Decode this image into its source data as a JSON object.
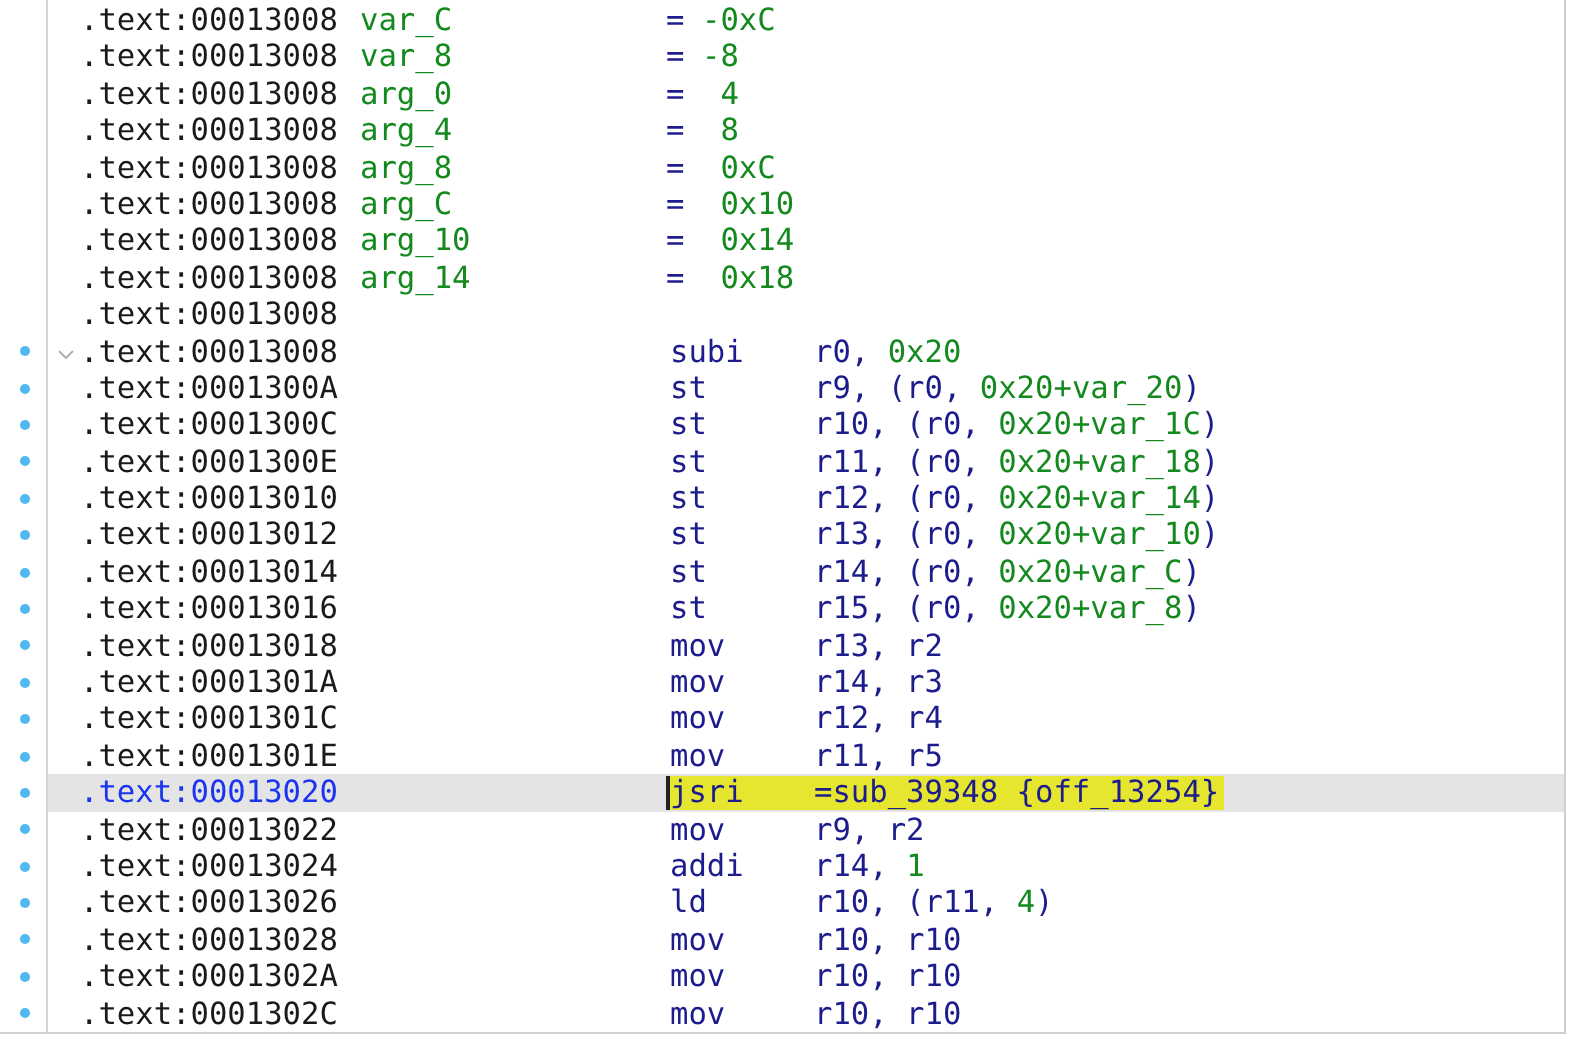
{
  "listing": {
    "rows": [
      {
        "kind": "stackvar",
        "address": ".text:00013008",
        "name": "var_C",
        "eq": "=",
        "value": "-0xC",
        "breakpoint": false,
        "selected": false
      },
      {
        "kind": "stackvar",
        "address": ".text:00013008",
        "name": "var_8",
        "eq": "=",
        "value": "-8",
        "breakpoint": false,
        "selected": false
      },
      {
        "kind": "stackvar",
        "address": ".text:00013008",
        "name": "arg_0",
        "eq": "=",
        "value": " 4",
        "breakpoint": false,
        "selected": false
      },
      {
        "kind": "stackvar",
        "address": ".text:00013008",
        "name": "arg_4",
        "eq": "=",
        "value": " 8",
        "breakpoint": false,
        "selected": false
      },
      {
        "kind": "stackvar",
        "address": ".text:00013008",
        "name": "arg_8",
        "eq": "=",
        "value": " 0xC",
        "breakpoint": false,
        "selected": false
      },
      {
        "kind": "stackvar",
        "address": ".text:00013008",
        "name": "arg_C",
        "eq": "=",
        "value": " 0x10",
        "breakpoint": false,
        "selected": false
      },
      {
        "kind": "stackvar",
        "address": ".text:00013008",
        "name": "arg_10",
        "eq": "=",
        "value": " 0x14",
        "breakpoint": false,
        "selected": false
      },
      {
        "kind": "stackvar",
        "address": ".text:00013008",
        "name": "arg_14",
        "eq": "=",
        "value": " 0x18",
        "breakpoint": false,
        "selected": false
      },
      {
        "kind": "blank",
        "address": ".text:00013008",
        "breakpoint": false,
        "selected": false
      },
      {
        "kind": "insn",
        "address": ".text:00013008",
        "collapsible": true,
        "mnemonic": "subi",
        "operands": [
          {
            "text": "r0, ",
            "kind": "plain"
          },
          {
            "text": "0x20",
            "kind": "const"
          }
        ],
        "breakpoint": true,
        "selected": false
      },
      {
        "kind": "insn",
        "address": ".text:0001300A",
        "mnemonic": "st",
        "operands": [
          {
            "text": "r9, (r0, ",
            "kind": "plain"
          },
          {
            "text": "0x20+var_20",
            "kind": "const"
          },
          {
            "text": ")",
            "kind": "plain"
          }
        ],
        "breakpoint": true,
        "selected": false
      },
      {
        "kind": "insn",
        "address": ".text:0001300C",
        "mnemonic": "st",
        "operands": [
          {
            "text": "r10, (r0, ",
            "kind": "plain"
          },
          {
            "text": "0x20+var_1C",
            "kind": "const"
          },
          {
            "text": ")",
            "kind": "plain"
          }
        ],
        "breakpoint": true,
        "selected": false
      },
      {
        "kind": "insn",
        "address": ".text:0001300E",
        "mnemonic": "st",
        "operands": [
          {
            "text": "r11, (r0, ",
            "kind": "plain"
          },
          {
            "text": "0x20+var_18",
            "kind": "const"
          },
          {
            "text": ")",
            "kind": "plain"
          }
        ],
        "breakpoint": true,
        "selected": false
      },
      {
        "kind": "insn",
        "address": ".text:00013010",
        "mnemonic": "st",
        "operands": [
          {
            "text": "r12, (r0, ",
            "kind": "plain"
          },
          {
            "text": "0x20+var_14",
            "kind": "const"
          },
          {
            "text": ")",
            "kind": "plain"
          }
        ],
        "breakpoint": true,
        "selected": false
      },
      {
        "kind": "insn",
        "address": ".text:00013012",
        "mnemonic": "st",
        "operands": [
          {
            "text": "r13, (r0, ",
            "kind": "plain"
          },
          {
            "text": "0x20+var_10",
            "kind": "const"
          },
          {
            "text": ")",
            "kind": "plain"
          }
        ],
        "breakpoint": true,
        "selected": false
      },
      {
        "kind": "insn",
        "address": ".text:00013014",
        "mnemonic": "st",
        "operands": [
          {
            "text": "r14, (r0, ",
            "kind": "plain"
          },
          {
            "text": "0x20+var_C",
            "kind": "const"
          },
          {
            "text": ")",
            "kind": "plain"
          }
        ],
        "breakpoint": true,
        "selected": false
      },
      {
        "kind": "insn",
        "address": ".text:00013016",
        "mnemonic": "st",
        "operands": [
          {
            "text": "r15, (r0, ",
            "kind": "plain"
          },
          {
            "text": "0x20+var_8",
            "kind": "const"
          },
          {
            "text": ")",
            "kind": "plain"
          }
        ],
        "breakpoint": true,
        "selected": false
      },
      {
        "kind": "insn",
        "address": ".text:00013018",
        "mnemonic": "mov",
        "operands": [
          {
            "text": "r13, r2",
            "kind": "plain"
          }
        ],
        "breakpoint": true,
        "selected": false
      },
      {
        "kind": "insn",
        "address": ".text:0001301A",
        "mnemonic": "mov",
        "operands": [
          {
            "text": "r14, r3",
            "kind": "plain"
          }
        ],
        "breakpoint": true,
        "selected": false
      },
      {
        "kind": "insn",
        "address": ".text:0001301C",
        "mnemonic": "mov",
        "operands": [
          {
            "text": "r12, r4",
            "kind": "plain"
          }
        ],
        "breakpoint": true,
        "selected": false
      },
      {
        "kind": "insn",
        "address": ".text:0001301E",
        "mnemonic": "mov",
        "operands": [
          {
            "text": "r11, r5",
            "kind": "plain"
          }
        ],
        "breakpoint": true,
        "selected": false
      },
      {
        "kind": "insn",
        "address": ".text:00013020",
        "mnemonic": "jsri",
        "operands": [
          {
            "text": "=sub_39348 {off_13254}",
            "kind": "plain"
          }
        ],
        "breakpoint": true,
        "selected": true
      },
      {
        "kind": "insn",
        "address": ".text:00013022",
        "mnemonic": "mov",
        "operands": [
          {
            "text": "r9, r2",
            "kind": "plain"
          }
        ],
        "breakpoint": true,
        "selected": false
      },
      {
        "kind": "insn",
        "address": ".text:00013024",
        "mnemonic": "addi",
        "operands": [
          {
            "text": "r14, ",
            "kind": "plain"
          },
          {
            "text": "1",
            "kind": "const"
          }
        ],
        "breakpoint": true,
        "selected": false
      },
      {
        "kind": "insn",
        "address": ".text:00013026",
        "mnemonic": "ld",
        "operands": [
          {
            "text": "r10, (r11, ",
            "kind": "plain"
          },
          {
            "text": "4",
            "kind": "const"
          },
          {
            "text": ")",
            "kind": "plain"
          }
        ],
        "breakpoint": true,
        "selected": false
      },
      {
        "kind": "insn",
        "address": ".text:00013028",
        "mnemonic": "mov",
        "operands": [
          {
            "text": "r10, r10",
            "kind": "plain"
          }
        ],
        "breakpoint": true,
        "selected": false
      },
      {
        "kind": "insn",
        "address": ".text:0001302A",
        "mnemonic": "mov",
        "operands": [
          {
            "text": "r10, r10",
            "kind": "plain"
          }
        ],
        "breakpoint": true,
        "selected": false
      },
      {
        "kind": "insn",
        "address": ".text:0001302C",
        "mnemonic": "mov",
        "operands": [
          {
            "text": "r10, r10",
            "kind": "plain"
          }
        ],
        "breakpoint": true,
        "selected": false
      }
    ]
  }
}
